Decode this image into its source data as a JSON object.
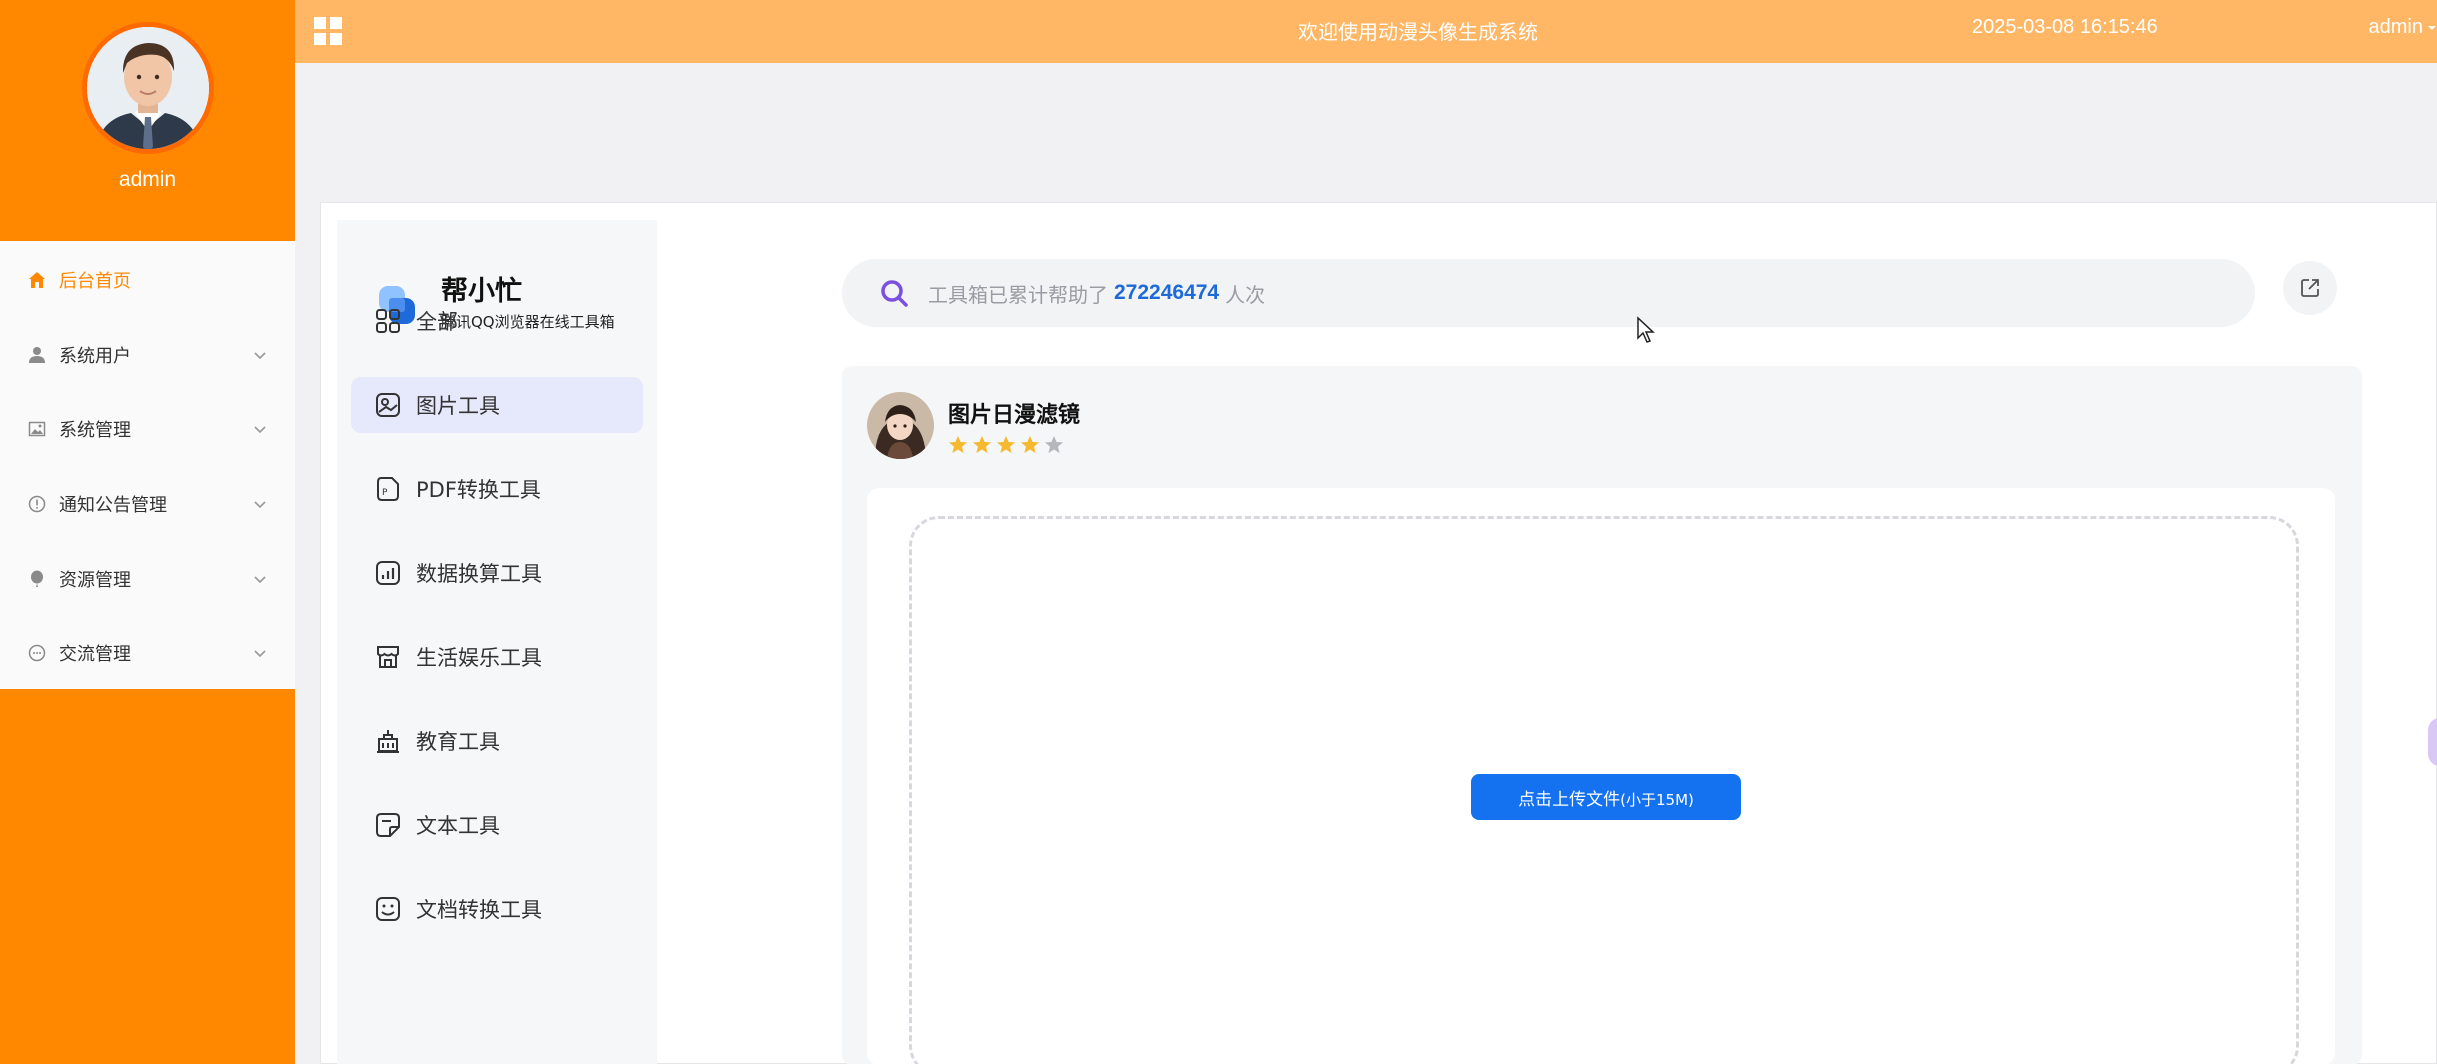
{
  "sidebar": {
    "user_name": "admin",
    "items": [
      {
        "label": "后台首页",
        "icon": "home-icon",
        "active": true
      },
      {
        "label": "系统用户",
        "icon": "user-icon"
      },
      {
        "label": "系统管理",
        "icon": "image-icon"
      },
      {
        "label": "通知公告管理",
        "icon": "info-icon"
      },
      {
        "label": "资源管理",
        "icon": "balloon-icon"
      },
      {
        "label": "交流管理",
        "icon": "chat-icon"
      }
    ]
  },
  "header": {
    "title": "欢迎使用动漫头像生成系统",
    "datetime": "2025-03-08 16:15:46",
    "user": "admin"
  },
  "toolbox": {
    "brand_name": "帮小忙",
    "brand_sub": "腾讯QQ浏览器在线工具箱",
    "categories": [
      {
        "label": "全部",
        "icon": "grid-icon"
      },
      {
        "label": "图片工具",
        "icon": "picture-icon",
        "active": true
      },
      {
        "label": "PDF转换工具",
        "icon": "pdf-icon"
      },
      {
        "label": "数据换算工具",
        "icon": "chart-icon"
      },
      {
        "label": "生活娱乐工具",
        "icon": "store-icon"
      },
      {
        "label": "教育工具",
        "icon": "building-icon"
      },
      {
        "label": "文本工具",
        "icon": "note-icon"
      },
      {
        "label": "文档转换工具",
        "icon": "doc-convert-icon"
      }
    ],
    "search": {
      "prefix": "工具箱已累计帮助了",
      "count": "272246474",
      "suffix": "人次"
    },
    "tool": {
      "name": "图片日漫滤镜",
      "rating": 4,
      "rating_max": 5,
      "upload_label": "点击上传文件",
      "upload_hint": "(小于15M)"
    }
  },
  "colors": {
    "sidebar": "#ff8800",
    "header": "#ffb766",
    "accent_blue": "#1471ef",
    "star": "#f5b82e"
  }
}
